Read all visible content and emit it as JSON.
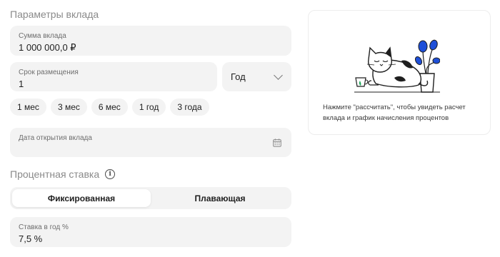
{
  "params": {
    "title": "Параметры вклада"
  },
  "sum": {
    "label": "Сумма вклада",
    "value": "1 000 000,0 ₽"
  },
  "term": {
    "label": "Срок размещения",
    "value": "1"
  },
  "unit": {
    "value": "Год"
  },
  "chips": [
    "1 мес",
    "3 мес",
    "6 мес",
    "1 год",
    "3 года"
  ],
  "date": {
    "label": "Дата открытия вклада",
    "value": ""
  },
  "rate_section": {
    "title": "Процентная ставка"
  },
  "rate_type": {
    "fixed": "Фиксированная",
    "floating": "Плавающая",
    "selected": "fixed"
  },
  "rate": {
    "label": "Ставка в год %",
    "value": "7,5 %"
  },
  "result": {
    "text": "Нажмите \"рассчитать\", чтобы увидеть расчет вклада и график начисления процентов"
  },
  "colors": {
    "field_bg": "#f3f3f3",
    "plant_blue": "#1e4fd8",
    "accent_green": "#1fa85a"
  },
  "icons": {
    "info": "info-icon",
    "chevron": "chevron-down-icon",
    "calendar": "calendar-icon",
    "illustration": "sleeping-cat-illustration"
  }
}
